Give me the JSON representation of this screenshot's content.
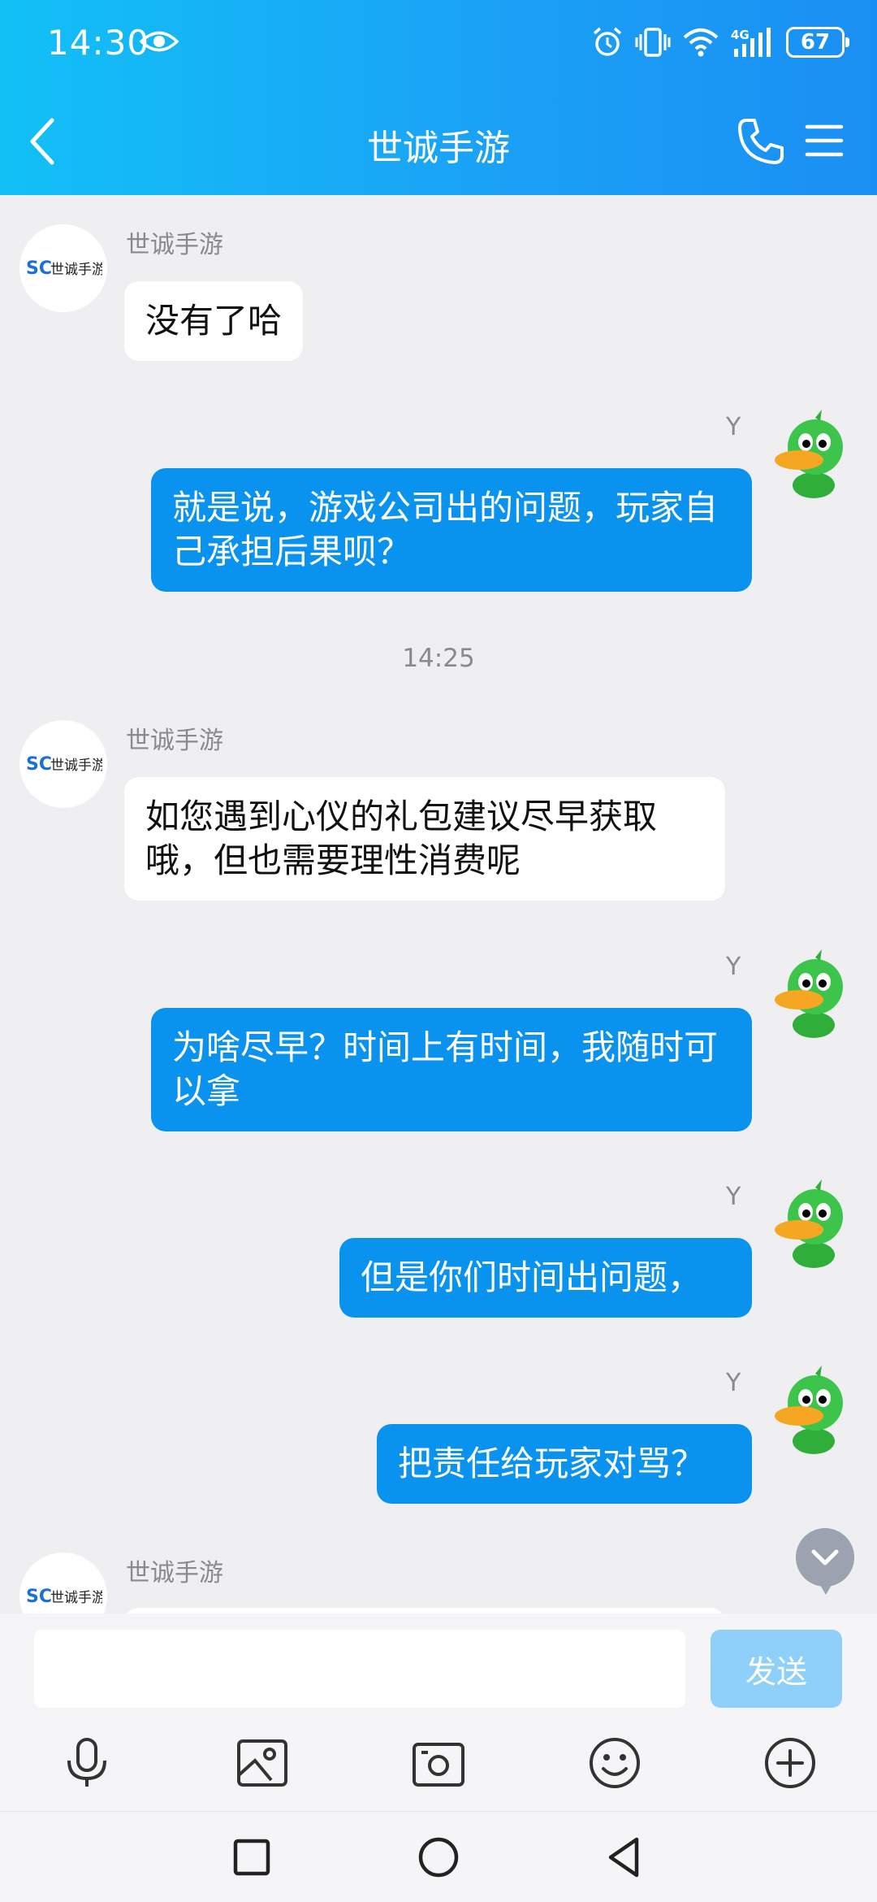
{
  "status_bar": {
    "time": "14:30",
    "battery": "67",
    "network": "4G"
  },
  "header": {
    "title": "世诚手游"
  },
  "messages": [
    {
      "side": "in",
      "sender": "世诚手游",
      "text": "没有了哈"
    },
    {
      "side": "out",
      "sender": "Y",
      "text": "就是说，游戏公司出的问题，玩家自己承担后果呗？"
    },
    {
      "type": "time",
      "text": "14:25"
    },
    {
      "side": "in",
      "sender": "世诚手游",
      "text": "如您遇到心仪的礼包建议尽早获取哦，但也需要理性消费呢"
    },
    {
      "side": "out",
      "sender": "Y",
      "text": "为啥尽早？时间上有时间，我随时可以拿"
    },
    {
      "side": "out",
      "sender": "Y",
      "text": "但是你们时间出问题，"
    },
    {
      "side": "out",
      "sender": "Y",
      "text": "把责任给玩家对骂？"
    },
    {
      "side": "in",
      "sender": "世诚手游",
      "text": ""
    }
  ],
  "avatar_logo": {
    "prefix": "SC",
    "text": "世诚手游"
  },
  "input": {
    "placeholder": "",
    "value": ""
  },
  "send_button": {
    "label": "发送"
  },
  "colors": {
    "accent": "#0a93ee",
    "header_start": "#12c0f6",
    "header_end": "#1a8ff3",
    "send_disabled": "#8fd0fb"
  },
  "toolbar_icons": [
    "microphone-icon",
    "image-icon",
    "camera-icon",
    "emoji-icon",
    "plus-icon"
  ],
  "nav_icons": [
    "recents-square-icon",
    "home-circle-icon",
    "back-triangle-icon"
  ]
}
